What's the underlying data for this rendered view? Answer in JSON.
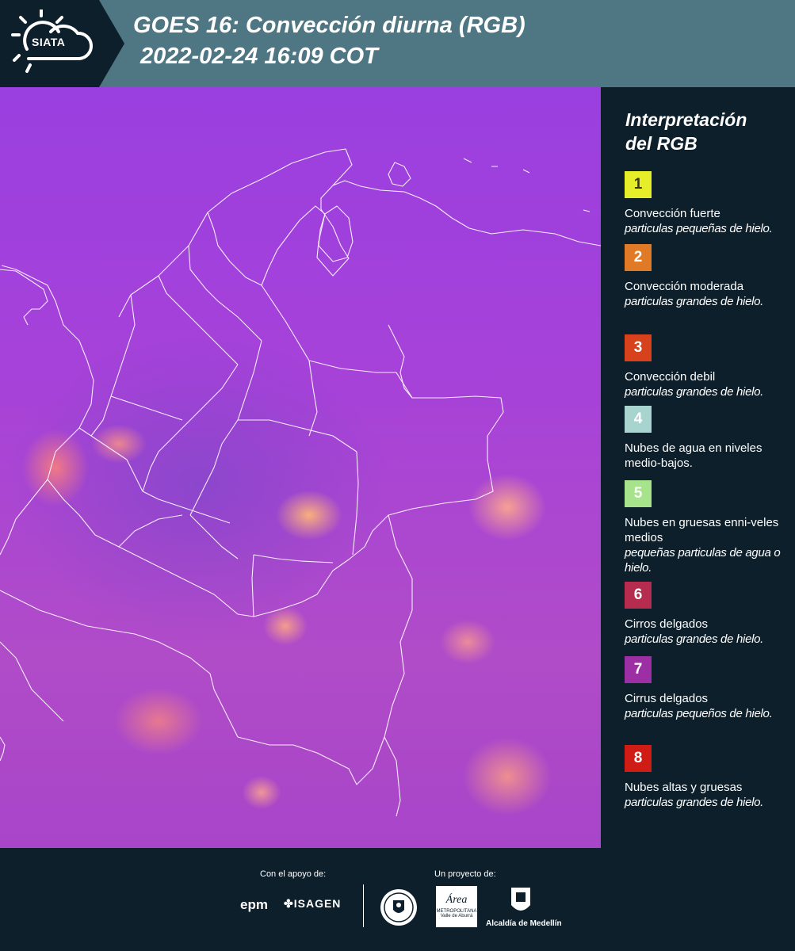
{
  "header": {
    "logo_text": "SIATA",
    "title_line1": "GOES 16: Convección diurna (RGB)",
    "title_line2": "2022-02-24 16:09 COT"
  },
  "legend": {
    "title_line1": "Interpretación",
    "title_line2": "del RGB",
    "items": [
      {
        "number": "1",
        "color": "#e6ee2a",
        "text_color": "#3a3a10",
        "name": "Convección fuerte",
        "desc": "particulas pequeñas de hielo."
      },
      {
        "number": "2",
        "color": "#e07a26",
        "text_color": "#ffffff",
        "name": "Convección moderada",
        "desc": "particulas grandes de hielo."
      },
      {
        "number": "3",
        "color": "#d7411b",
        "text_color": "#ffffff",
        "name": "Convección debil",
        "desc": "particulas grandes de hielo."
      },
      {
        "number": "4",
        "color": "#a8d4d0",
        "text_color": "#ffffff",
        "name": "Nubes de agua en niveles medio-bajos.",
        "desc": ""
      },
      {
        "number": "5",
        "color": "#a6e38a",
        "text_color": "#ffffff",
        "name": "Nubes en gruesas enni-veles medios",
        "desc": "pequeñas particulas de agua o hielo."
      },
      {
        "number": "6",
        "color": "#b52c4e",
        "text_color": "#ffffff",
        "name": "Cirros delgados",
        "desc": "particulas grandes de hielo."
      },
      {
        "number": "7",
        "color": "#9b2fa3",
        "text_color": "#ffffff",
        "name": "Cirrus delgados",
        "desc": "particulas pequeños de hielo."
      },
      {
        "number": "8",
        "color": "#cf1d16",
        "text_color": "#ffffff",
        "name": "Nubes altas y gruesas",
        "desc": "particulas grandes de hielo."
      }
    ]
  },
  "footer": {
    "support_label": "Con el apoyo de:",
    "project_label": "Un proyecto de:",
    "sponsors": {
      "epm": "epm",
      "isagen": "ISAGEN",
      "area_name": "Área",
      "area_sub1": "METROPOLITANA",
      "area_sub2": "Valle de Aburrá",
      "alcaldia": "Alcaldía de Medellín"
    }
  }
}
